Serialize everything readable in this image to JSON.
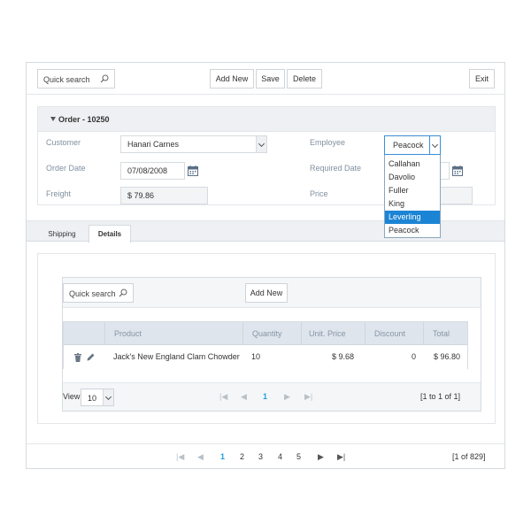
{
  "toolbar": {
    "search_placeholder": "Quick search",
    "add_new": "Add New",
    "save": "Save",
    "delete": "Delete",
    "exit": "Exit"
  },
  "order": {
    "header": "Order - 10250",
    "customer_label": "Customer",
    "customer_value": "Hanari Carnes",
    "employee_label": "Employee",
    "employee_value": "Peacock",
    "order_date_label": "Order Date",
    "order_date_value": "07/08/2008",
    "required_date_label": "Required Date",
    "freight_label": "Freight",
    "freight_value": "$ 79.86",
    "price_label": "Price"
  },
  "employee_dropdown": {
    "options": [
      "Callahan",
      "Davolio",
      "Fuller",
      "King",
      "Leverling",
      "Peacock"
    ],
    "selected": "Leverling"
  },
  "tabs": [
    {
      "label": "Shipping",
      "active": false
    },
    {
      "label": "Details",
      "active": true
    }
  ],
  "details": {
    "search_placeholder": "Quick search",
    "add_new": "Add New",
    "columns": [
      "Product",
      "Quantity",
      "Unit. Price",
      "Discount",
      "Total"
    ],
    "rows": [
      {
        "product": "Jack's New England Clam Chowder",
        "quantity": "10",
        "unit_price": "$ 9.68",
        "discount": "0",
        "total": "$ 96.80"
      }
    ],
    "view_label": "View",
    "view_value": "10",
    "current_page": "1",
    "range": "[1 to 1 of 1]"
  },
  "bottom_pager": {
    "pages": [
      "1",
      "2",
      "3",
      "4",
      "5"
    ],
    "current_page": "1",
    "summary": "[1 of 829]"
  },
  "colors": {
    "accent": "#1c84d4",
    "page_active": "#1ea0d8",
    "header_bg": "#eef0f3",
    "grid_header_bg": "#dfe5ec"
  }
}
